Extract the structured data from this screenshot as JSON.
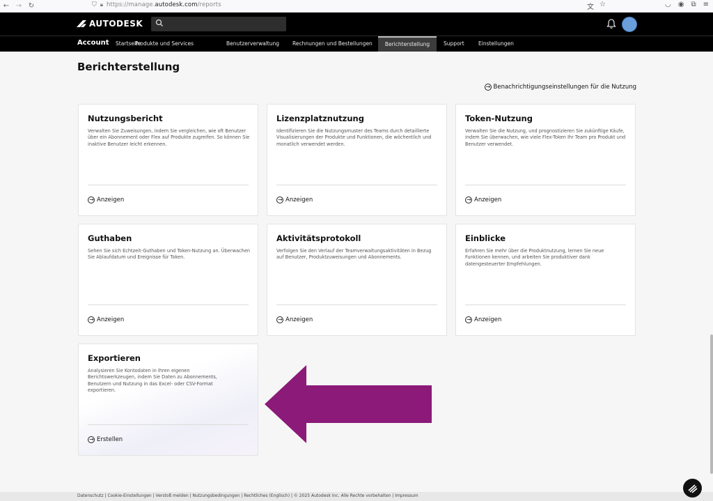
{
  "browser": {
    "back": "←",
    "forward": "→",
    "reload": "↻",
    "url_prefix": "https://manage.",
    "url_domain": "autodesk.com",
    "url_path": "/reports"
  },
  "header": {
    "logo_text": "AUTODESK",
    "search_placeholder": ""
  },
  "account_nav": {
    "brand": "Account",
    "items": [
      {
        "label": "Startseite"
      },
      {
        "label": "Produkte und Services"
      },
      {
        "label": "Benutzerverwaltung"
      },
      {
        "label": "Rechnungen und Bestellungen"
      },
      {
        "label": "Berichterstellung",
        "active": true
      },
      {
        "label": "Support"
      },
      {
        "label": "Einstellungen"
      }
    ]
  },
  "main": {
    "title": "Berichterstellung",
    "notif_link": "Benachrichtigungseinstellungen für die Nutzung",
    "cards": [
      {
        "title": "Nutzungsbericht",
        "desc": "Verwalten Sie Zuweisungen, indem Sie vergleichen, wie oft Benutzer über ein Abonnement oder Flex auf Produkte zugreifen. So können Sie inaktive Benutzer leicht erkennen.",
        "cta": "Anzeigen"
      },
      {
        "title": "Lizenzplatznutzung",
        "desc": "Identifizieren Sie die Nutzungsmuster des Teams durch detaillierte Visualisierungen der Produkte und Funktionen, die wöchentlich und monatlich verwendet werden.",
        "cta": "Anzeigen"
      },
      {
        "title": "Token-Nutzung",
        "desc": "Verwalten Sie die Nutzung, und prognostizieren Sie zukünftige Käufe, indem Sie überwachen, wie viele Flex-Token Ihr Team pro Produkt und Benutzer verwendet.",
        "cta": "Anzeigen"
      },
      {
        "title": "Guthaben",
        "desc": "Sehen Sie sich Echtzeit-Guthaben und Token-Nutzung an. Überwachen Sie Ablaufdatum und Ereignisse für Token.",
        "cta": "Anzeigen"
      },
      {
        "title": "Aktivitätsprotokoll",
        "desc": "Verfolgen Sie den Verlauf der Teamverwaltungsaktivitäten in Bezug auf Benutzer, Produktzuweisungen und Abonnements.",
        "cta": "Anzeigen"
      },
      {
        "title": "Einblicke",
        "desc": "Erfahren Sie mehr über die Produktnutzung, lernen Sie neue Funktionen kennen, und arbeiten Sie produktiver dank datengesteuerter Empfehlungen.",
        "cta": "Anzeigen"
      },
      {
        "title": "Exportieren",
        "desc": "Analysieren Sie Kontodaten in Ihren eigenen Berichtswerkzeugen, indem Sie Daten zu Abonnements, Benutzern und Nutzung in das Excel- oder CSV-Format exportieren.",
        "cta": "Erstellen"
      }
    ]
  },
  "footer": {
    "text": "Datenschutz | Cookie-Einstellungen | Verstoß melden | Nutzungsbedingungen | Rechtliches (Englisch) | © 2025 Autodesk Inc. Alle Rechte vorbehalten | Impressum"
  },
  "colors": {
    "annotation_arrow": "#8b1a78",
    "avatar": "#6a9fdc"
  }
}
